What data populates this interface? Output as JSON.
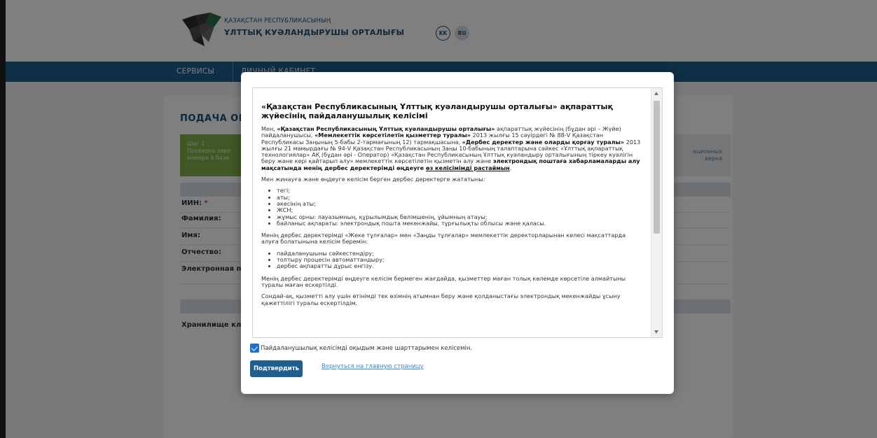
{
  "header": {
    "org_line1": "ҚАЗАҚСТАН РЕСПУБЛИКАСЫНЫҢ",
    "org_line2": "ҰЛТТЫҚ КУӘЛАНДЫРУШЫ ОРТАЛЫҒЫ",
    "languages": [
      "KK",
      "RU"
    ],
    "active_language": "KK"
  },
  "nav": {
    "services": "СЕРВИСЫ",
    "cabinet": "ЛИЧНЫЙ КАБИНЕТ"
  },
  "form": {
    "title": "ПОДАЧА ОНЛ",
    "step_label": "Шаг 1",
    "step_desc_line1": "Проверка заре",
    "step_desc_line2": "номера в базе",
    "step_right_line1": "ационных",
    "step_right_line2": "верка",
    "fields": {
      "iin": "ИИН:",
      "iin_required": "*",
      "surname": "Фамилия:",
      "name": "Имя:",
      "patronymic": "Отчество:",
      "email": "Электронная по",
      "storage": "Хранилище клю"
    }
  },
  "modal": {
    "title": "«Қазақстан Республикасының Ұлттық куәландырушы орталығы» ақпараттық жүйесінің пайдаланушылық келісімі",
    "p1_parts": [
      "Мен, ",
      "«Қазақстан Республикасының Ұлттық куәландырушы орталығы»",
      " ақпараттық жүйесінің (бұдан әрі – Жүйе) пайдаланушысы, ",
      "«Мемлекеттік көрсетілетін қызметтер туралы»",
      " 2013 жылғы 15 сәуірдегі № 88-V Қазақстан Республикасы Заңының 5-бабы 2-тармағының 12) тармақшасына, ",
      "«Дербес деректер және оларды қорғау туралы»",
      " 2013 жылғы 21 мамырдағы № 94-V Қазақстан Республикасының Заңы 10-бабының талаптарына сәйкес «Ұлттық ақпараттық технологиялар» АҚ (бұдан әрі - Оператор) «Қазақстан Республикасының Ұлттық куәландыру орталығының тіркеу куәлігін беру және кері қайтарып алу» мемлекеттік көрсетілетін қызметін алу және ",
      "электрондық поштаға хабарламаларды алу мақсатында менің дербес деректерімді өңдеуге ",
      "өз келісімімді растаймын"
    ],
    "p2": "Мен жинауға және өңдеуге келісім берген дербес деректерге жататыны:",
    "list1": [
      "тегі;",
      "аты;",
      "әкесінің аты;",
      "ЖСН;",
      "жұмыс орны: лауазымның, құрылымдық бөлімшенің, ұйымның атауы;",
      "байланыс ақпараты: электрондық пошта мекенжайы, тұрғылықты облысы және қаласы."
    ],
    "p3": "Менің дербес деректерімді «Жеке тұлғалар» мен «Заңды тұлғалар» мемлекеттік деректорларынан келесі мақсаттарда алуға болатынына келісім беремін:",
    "list2": [
      "пайдаланушыны сәйкестендіру;",
      "толтыру процесін автоматтандыру;",
      "дербес ақпаратты дұрыс енгізу."
    ],
    "p4": "Менің дербес деректерімді өңдеуге келісім бермеген жағдайда, қызметтер маған толық көлемде көрсетіле алмайтыны туралы маған ескертілді.",
    "p5": "Сондай-ақ, қызметті алу үшін өтінімді тек өзімнің атымнан беру және қолданыстағы электрондық мекенжайды ұсыну қажеттілігі туралы ескертілдім.",
    "consent_checked": true,
    "consent_label": "Пайдаланушылық келісімді оқыдым және шарттарымен келісемін.",
    "confirm_button": "Подтвердить",
    "back_link": "Вернуться на главную страницу"
  }
}
